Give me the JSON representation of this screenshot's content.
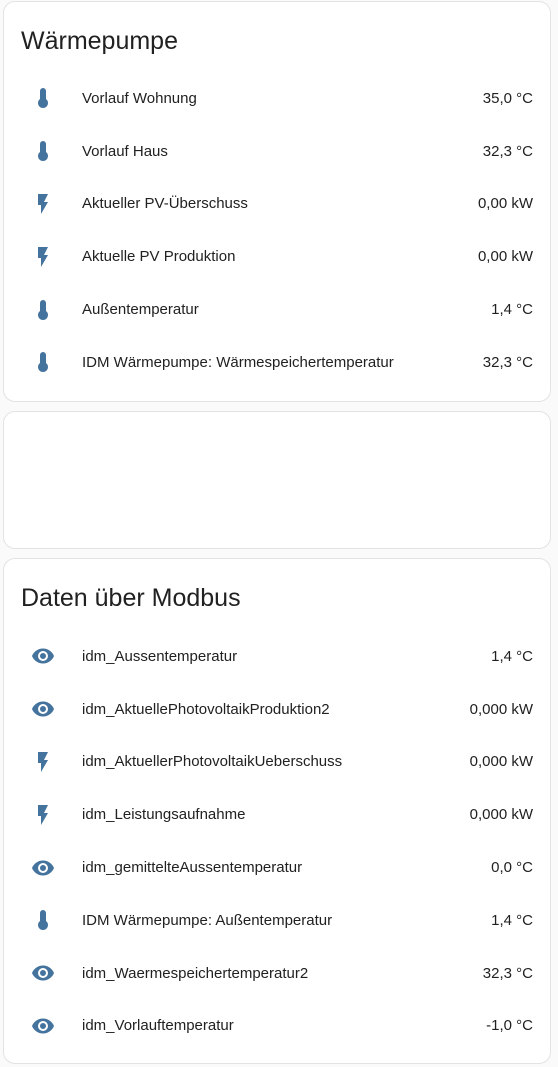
{
  "colors": {
    "icon": "#44739e",
    "card_bg": "#ffffff",
    "page_bg": "#fafafa"
  },
  "card1": {
    "title": "Wärmepumpe",
    "rows": [
      {
        "icon": "thermometer-icon",
        "label": "Vorlauf Wohnung",
        "value": "35,0 °C"
      },
      {
        "icon": "thermometer-icon",
        "label": "Vorlauf Haus",
        "value": "32,3 °C"
      },
      {
        "icon": "flash-icon",
        "label": "Aktueller PV-Überschuss",
        "value": "0,00 kW"
      },
      {
        "icon": "flash-icon",
        "label": "Aktuelle PV Produktion",
        "value": "0,00 kW"
      },
      {
        "icon": "thermometer-icon",
        "label": "Außentemperatur",
        "value": "1,4 °C"
      },
      {
        "icon": "thermometer-icon",
        "label": "IDM Wärmepumpe: Wärmespeichertemperatur",
        "value": "32,3 °C"
      }
    ]
  },
  "card3": {
    "title": "Daten über Modbus",
    "rows": [
      {
        "icon": "eye-icon",
        "label": "idm_Aussentemperatur",
        "value": "1,4 °C"
      },
      {
        "icon": "eye-icon",
        "label": "idm_AktuellePhotovoltaikProduktion2",
        "value": "0,000 kW"
      },
      {
        "icon": "flash-icon",
        "label": "idm_AktuellerPhotovoltaikUeberschuss",
        "value": "0,000 kW"
      },
      {
        "icon": "flash-icon",
        "label": "idm_Leistungsaufnahme",
        "value": "0,000 kW"
      },
      {
        "icon": "eye-icon",
        "label": "idm_gemittelteAussentemperatur",
        "value": "0,0 °C"
      },
      {
        "icon": "thermometer-icon",
        "label": "IDM Wärmepumpe: Außentemperatur",
        "value": "1,4 °C"
      },
      {
        "icon": "eye-icon",
        "label": "idm_Waermespeichertemperatur2",
        "value": "32,3 °C"
      },
      {
        "icon": "eye-icon",
        "label": "idm_Vorlauftemperatur",
        "value": "-1,0 °C"
      }
    ]
  }
}
